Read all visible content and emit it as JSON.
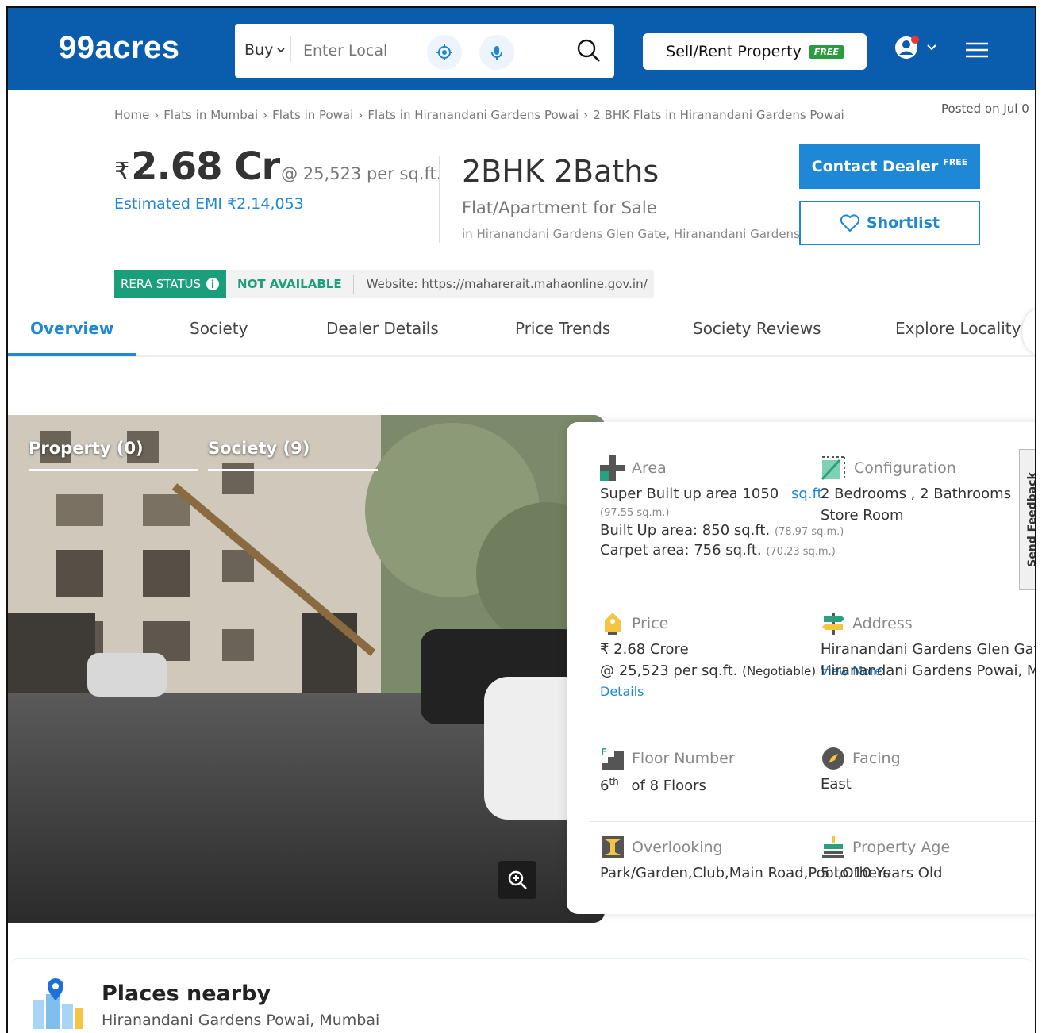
{
  "header": {
    "logo": "99acres",
    "search": {
      "buy_label": "Buy",
      "placeholder": "Enter Local"
    },
    "sell_button": "Sell/Rent Property",
    "free_badge": "FREE"
  },
  "breadcrumb": [
    "Home",
    "Flats in Mumbai",
    "Flats in Powai",
    "Flats in Hiranandani Gardens Powai",
    "2 BHK Flats in Hiranandani Gardens Powai"
  ],
  "posted": "Posted on Jul 0",
  "price": {
    "currency": "₹",
    "value": "2.68 Cr",
    "per_sqft": "@ 25,523 per sq.ft.",
    "emi": "Estimated EMI ₹2,14,053"
  },
  "property": {
    "title": "2BHK 2Baths",
    "type": "Flat/Apartment for Sale",
    "location": "in Hiranandani Gardens Glen Gate, Hiranandani Gardens Powai"
  },
  "buttons": {
    "contact": "Contact Dealer",
    "contact_badge": "FREE",
    "shortlist": "Shortlist"
  },
  "rera": {
    "status_label": "RERA STATUS",
    "status_value": "NOT AVAILABLE",
    "website": "Website: https://maharerait.mahaonline.gov.in/"
  },
  "tabs": [
    "Overview",
    "Society",
    "Dealer Details",
    "Price Trends",
    "Society Reviews",
    "Explore Locality"
  ],
  "gallery": {
    "tab_property": "Property (0)",
    "tab_society": "Society (9)"
  },
  "details": {
    "area": {
      "label": "Area",
      "super_built": "Super Built up area 1050",
      "unit_link": "sq.ft.",
      "super_built_sqm": "(97.55 sq.m.)",
      "built_up": "Built Up area: 850 sq.ft.",
      "built_up_sqm": "(78.97 sq.m.)",
      "carpet": "Carpet area: 756 sq.ft.",
      "carpet_sqm": "(70.23 sq.m.)"
    },
    "configuration": {
      "label": "Configuration",
      "line1": "2 Bedrooms , 2 Bathrooms",
      "line2": "Store Room"
    },
    "price": {
      "label": "Price",
      "line1": "₹ 2.68 Crore",
      "line2": "@ 25,523 per sq.ft.",
      "negotiable": "(Negotiable)",
      "view_more": "View More",
      "details_link": "Details"
    },
    "address": {
      "label": "Address",
      "line1": "Hiranandani Gardens Glen Gate",
      "line2": "Hiranandani Gardens Powai, Mumbai"
    },
    "floor": {
      "label": "Floor Number",
      "num": "6",
      "suffix": "th",
      "of": "of 8 Floors"
    },
    "facing": {
      "label": "Facing",
      "value": "East"
    },
    "overlooking": {
      "label": "Overlooking",
      "value": "Park/Garden,Club,Main Road,Pool,Others"
    },
    "age": {
      "label": "Property Age",
      "value": "5 to 10 Years Old"
    }
  },
  "feedback": "Send Feedback",
  "places": {
    "title": "Places nearby",
    "subtitle": "Hiranandani Gardens Powai, Mumbai"
  }
}
